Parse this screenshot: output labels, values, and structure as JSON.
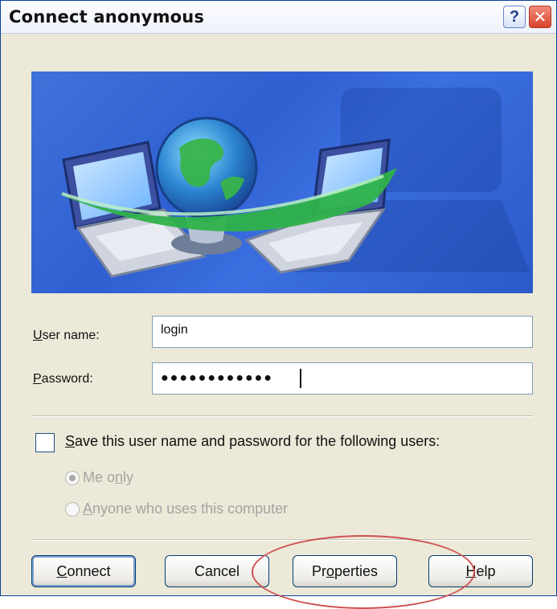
{
  "window": {
    "title": "Connect anonymous",
    "help_button": "?",
    "close_button": "✕"
  },
  "form": {
    "username_label": {
      "pre": "",
      "u": "U",
      "post": "ser name:"
    },
    "username_value": "login",
    "password_label": {
      "pre": "",
      "u": "P",
      "post": "assword:"
    },
    "password_value": "●●●●●●●●●●●●"
  },
  "save": {
    "checkbox_label": {
      "pre": "",
      "u": "S",
      "post": "ave this user name and password for the following users:"
    },
    "checked": false,
    "options": [
      {
        "label": {
          "pre": "Me o",
          "u": "n",
          "post": "ly"
        },
        "selected": true
      },
      {
        "label": {
          "pre": "",
          "u": "A",
          "post": "nyone who uses this computer"
        },
        "selected": false
      }
    ]
  },
  "buttons": {
    "connect": {
      "pre": "",
      "u": "C",
      "post": "onnect"
    },
    "cancel": {
      "pre": "Cancel",
      "u": "",
      "post": ""
    },
    "properties": {
      "pre": "Pr",
      "u": "o",
      "post": "perties"
    },
    "help": {
      "pre": "",
      "u": "H",
      "post": "elp"
    }
  },
  "colors": {
    "dialog_bg": "#ece9d8",
    "banner_blue": "#3466d6",
    "annotation_red": "#d05050"
  }
}
